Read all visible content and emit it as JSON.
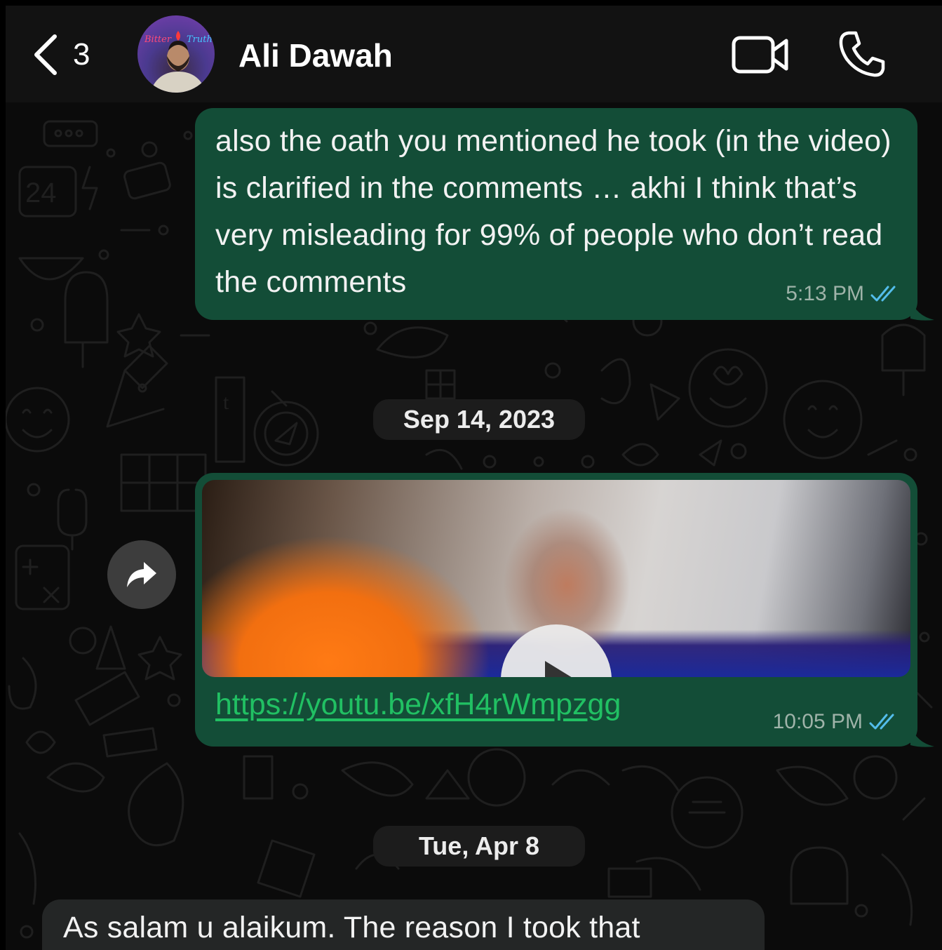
{
  "header": {
    "back_count": "3",
    "contact_name": "Ali Dawah",
    "avatar_sign_left": "Bitter",
    "avatar_sign_right": "Truth"
  },
  "messages": [
    {
      "direction": "outgoing",
      "text": "also the oath you mentioned he took (in the video) is clarified in the comments … akhi I think that’s very misleading for 99% of people who don’t read the comments",
      "time": "5:13 PM",
      "status": "read"
    },
    {
      "direction": "outgoing",
      "type": "link-preview",
      "link": "https://youtu.be/xfH4rWmpzgg",
      "time": "10:05 PM",
      "status": "read"
    },
    {
      "direction": "incoming",
      "text": "As salam u alaikum. The reason I took that"
    }
  ],
  "date_separators": [
    "Sep 14, 2023",
    "Tue, Apr 8"
  ],
  "colors": {
    "outgoing_bubble": "#134d37",
    "incoming_bubble": "#242626",
    "link": "#21c063",
    "read_ticks": "#53bdeb",
    "background": "#0b0b0b"
  },
  "icons": [
    "chevron-left-icon",
    "video-camera-icon",
    "phone-icon",
    "forward-icon",
    "play-icon",
    "double-check-icon"
  ]
}
